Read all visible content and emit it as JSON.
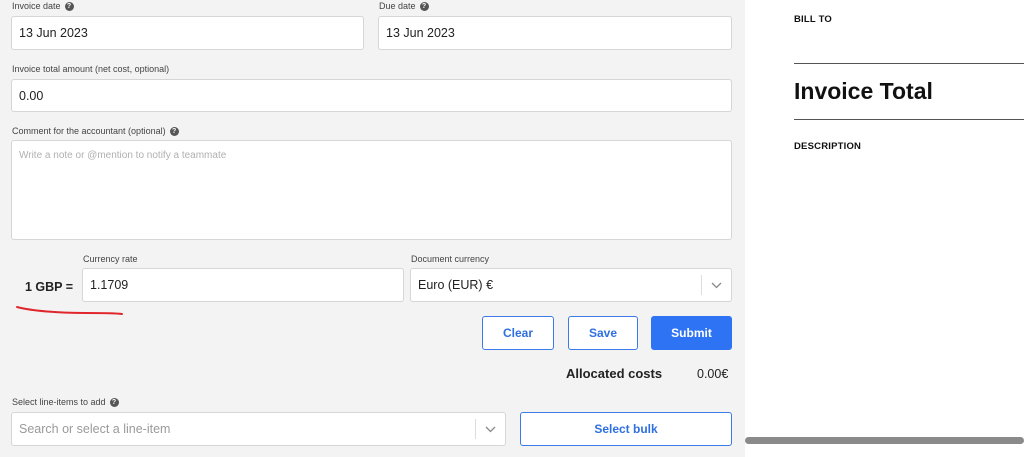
{
  "form": {
    "invoice_date": {
      "label": "Invoice date",
      "value": "13 Jun 2023"
    },
    "due_date": {
      "label": "Due date",
      "value": "13 Jun 2023"
    },
    "total_amount": {
      "label": "Invoice total amount (net cost, optional)",
      "value": "0.00"
    },
    "comment": {
      "label": "Comment for the accountant (optional)",
      "placeholder": "Write a note or @mention to notify a teammate"
    },
    "currency_rate": {
      "prefix": "1 GBP =",
      "label": "Currency rate",
      "value": "1.1709"
    },
    "document_currency": {
      "label": "Document currency",
      "value": "Euro (EUR) €"
    },
    "buttons": {
      "clear": "Clear",
      "save": "Save",
      "submit": "Submit"
    },
    "allocated": {
      "label": "Allocated costs",
      "value": "0.00€"
    },
    "line_items": {
      "label": "Select line-items to add",
      "placeholder": "Search or select a line-item",
      "bulk_button": "Select bulk"
    }
  },
  "preview": {
    "bill_to": "BILL TO",
    "title": "Invoice Total",
    "description": "DESCRIPTION"
  },
  "colors": {
    "accent": "#2f73f5",
    "annotation": "#e0262c"
  },
  "icons": {
    "help": "help-circle-icon",
    "chevron": "chevron-down-icon"
  }
}
